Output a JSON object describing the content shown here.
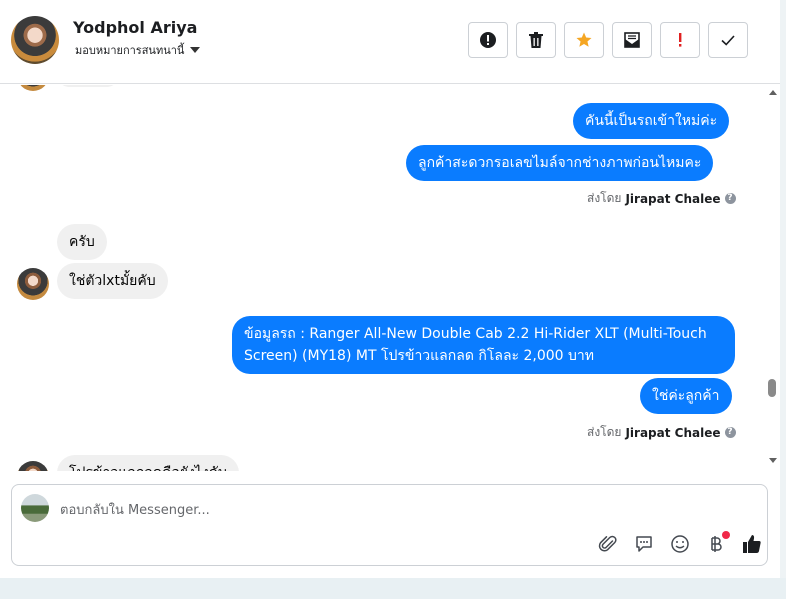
{
  "header": {
    "name": "Yodphol Ariya",
    "assign_label": "มอบหมายการสนทนานี้",
    "actions": [
      {
        "icon": "alert-circle-icon"
      },
      {
        "icon": "trash-icon"
      },
      {
        "icon": "star-icon",
        "color": "#f5a623"
      },
      {
        "icon": "mail-icon"
      },
      {
        "icon": "exclamation-icon",
        "color": "#e02020"
      },
      {
        "icon": "check-icon"
      }
    ]
  },
  "messages": {
    "m1": "คันนี้เป็นรถเข้าใหม่ค่ะ",
    "m2": "ลูกค้าสะดวกรอเลขไมล์จากช่างภาพก่อนไหมคะ",
    "sent1_prefix": "ส่งโดย",
    "sent1_name": "Jirapat Chalee",
    "r1": "ครับ",
    "r2": "ใช่ตัวlxtมั้ยคับ",
    "m3_line1": "ข้อมูลรถ : Ranger All-New Double Cab 2.2 Hi-Rider XLT (Multi-Touch",
    "m3_line2": "Screen) (MY18) MT โปรข้าวแลกลด กิโลละ 2,000 บาท",
    "m4": "ใช่ค่ะลูกค้า",
    "sent2_prefix": "ส่งโดย",
    "sent2_name": "Jirapat Chalee",
    "partial_bottom": "โปรข้าวแลกลดคือยังไงคับ"
  },
  "composer": {
    "placeholder": "ตอบกลับใน Messenger...",
    "tools": [
      "paperclip-icon",
      "speech-bubble-icon",
      "smiley-icon",
      "baht-icon",
      "thumbs-up-icon"
    ]
  },
  "colors": {
    "outgoing": "#0a7cff",
    "incoming": "#f0f0f0",
    "accent_star": "#f5a623",
    "alert_red": "#e02020"
  }
}
